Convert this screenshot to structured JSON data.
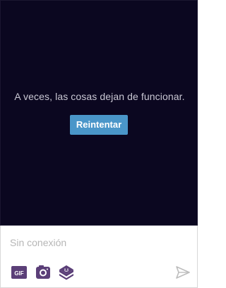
{
  "error": {
    "message": "A veces, las cosas dejan de funcionar.",
    "retry_label": "Reintentar"
  },
  "composer": {
    "placeholder": "Sin conexión",
    "gif_label": "GIF"
  },
  "icons": {
    "gif": "gif-icon",
    "camera": "camera-icon",
    "sticker": "sticker-icon",
    "send": "send-icon"
  },
  "colors": {
    "panel_background": "#0b0720",
    "error_text": "#c9c7d3",
    "retry_button": "#4a96c9",
    "icon_purple": "#5b3f78",
    "send_icon": "#bdbdbd",
    "placeholder": "#b6b6b6"
  }
}
